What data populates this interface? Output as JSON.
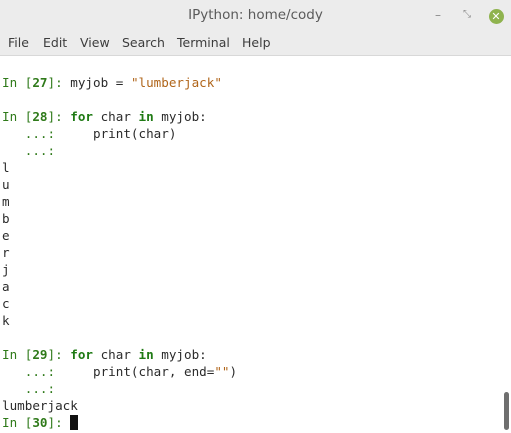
{
  "window": {
    "title": "IPython: home/cody",
    "controls": {
      "minimize": "–",
      "maximize": "⤡",
      "close": "✕"
    }
  },
  "menu": {
    "file": "File",
    "edit": "Edit",
    "view": "View",
    "search": "Search",
    "terminal": "Terminal",
    "help": "Help"
  },
  "terminal": {
    "in27": {
      "prompt_in": "In [",
      "prompt_num": "27",
      "prompt_end": "]: ",
      "code_a": "myjob = ",
      "code_str": "\"lumberjack\""
    },
    "in28": {
      "prompt_in": "In [",
      "prompt_num": "28",
      "prompt_end": "]: ",
      "kw_for": "for",
      "code_a": " char ",
      "kw_in": "in",
      "code_b": " myjob:"
    },
    "cont1_prompt": "   ...: ",
    "cont1_code": "    print(char)",
    "cont2_prompt": "   ...:",
    "output_chars": [
      "l",
      "u",
      "m",
      "b",
      "e",
      "r",
      "j",
      "a",
      "c",
      "k"
    ],
    "in29": {
      "prompt_in": "In [",
      "prompt_num": "29",
      "prompt_end": "]: ",
      "kw_for": "for",
      "code_a": " char ",
      "kw_in": "in",
      "code_b": " myjob:"
    },
    "cont3_prompt": "   ...: ",
    "cont3_code_a": "    print(char, end=",
    "cont3_str": "\"\"",
    "cont3_code_b": ")",
    "cont4_prompt": "   ...:",
    "output_joined": "lumberjack",
    "in30": {
      "prompt_in": "In [",
      "prompt_num": "30",
      "prompt_end": "]: "
    }
  },
  "colors": {
    "prompt": "#2f7a1a",
    "keyword": "#1f7a14",
    "string": "#b0651a",
    "text": "#2b2b2b",
    "close_button": "#8fb34e"
  }
}
